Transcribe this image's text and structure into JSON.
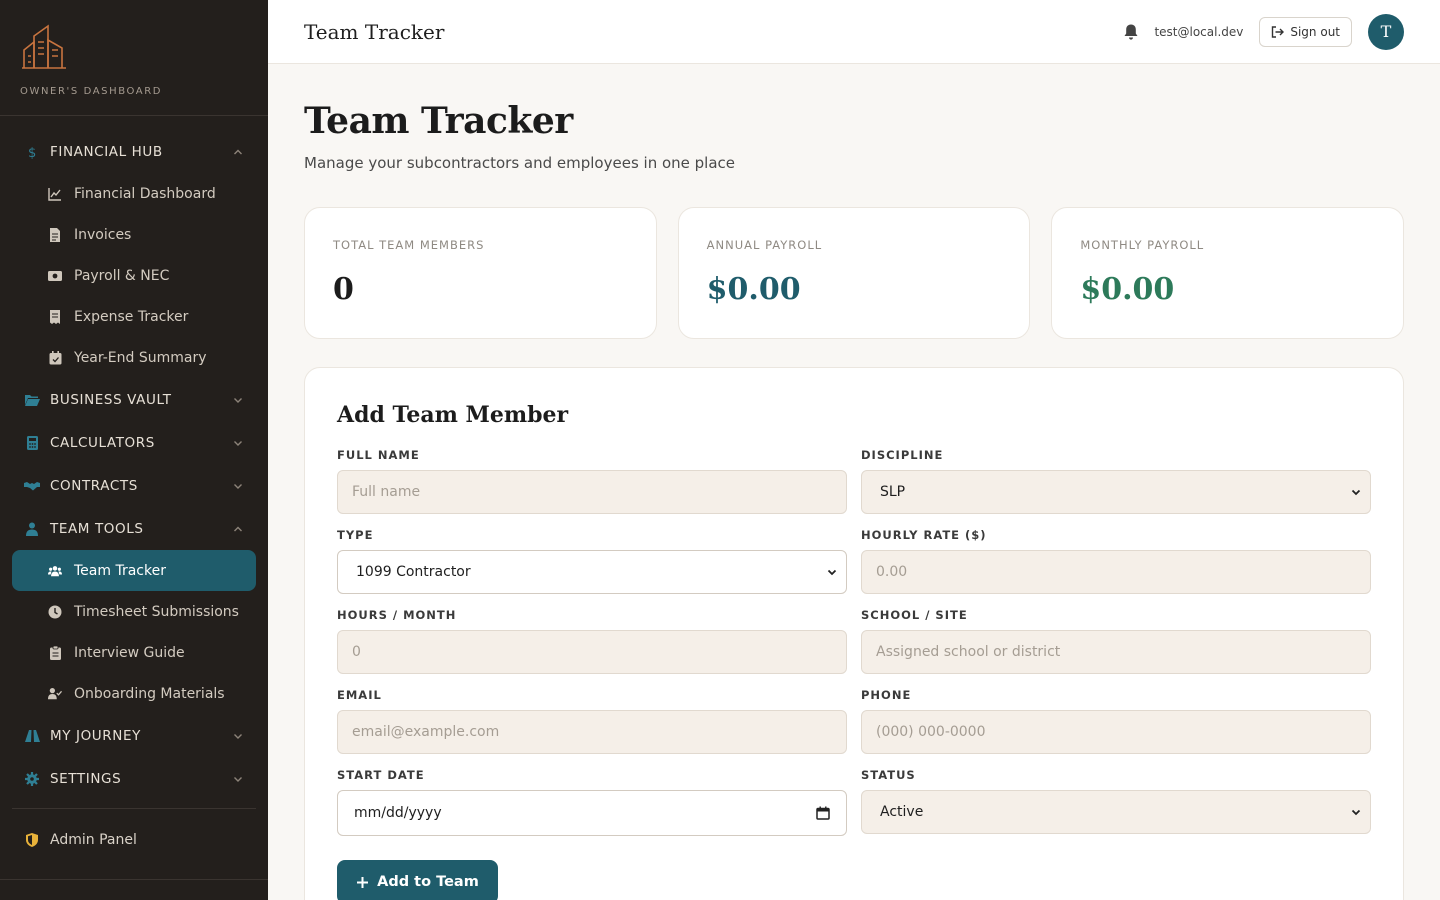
{
  "brand": {
    "text": "OWNER'S DASHBOARD"
  },
  "sidebar": {
    "financial_hub": {
      "label": "FINANCIAL HUB",
      "items": [
        {
          "label": "Financial Dashboard",
          "icon": "chart-line-icon"
        },
        {
          "label": "Invoices",
          "icon": "file-icon"
        },
        {
          "label": "Payroll & NEC",
          "icon": "money-icon"
        },
        {
          "label": "Expense Tracker",
          "icon": "receipt-icon"
        },
        {
          "label": "Year-End Summary",
          "icon": "calendar-icon"
        }
      ]
    },
    "business_vault": {
      "label": "BUSINESS VAULT"
    },
    "calculators": {
      "label": "CALCULATORS"
    },
    "contracts": {
      "label": "CONTRACTS"
    },
    "team_tools": {
      "label": "TEAM TOOLS",
      "items": [
        {
          "label": "Team Tracker",
          "icon": "users-icon",
          "active": true
        },
        {
          "label": "Timesheet Submissions",
          "icon": "clock-icon"
        },
        {
          "label": "Interview Guide",
          "icon": "clipboard-icon"
        },
        {
          "label": "Onboarding Materials",
          "icon": "user-check-icon"
        }
      ]
    },
    "my_journey": {
      "label": "MY JOURNEY"
    },
    "settings": {
      "label": "SETTINGS"
    },
    "admin": {
      "label": "Admin Panel"
    }
  },
  "topbar": {
    "title": "Team Tracker",
    "email": "test@local.dev",
    "signout": "Sign out",
    "avatar_initial": "T"
  },
  "page": {
    "title": "Team Tracker",
    "subtitle": "Manage your subcontractors and employees in one place"
  },
  "stats": [
    {
      "label": "TOTAL TEAM MEMBERS",
      "value": "0"
    },
    {
      "label": "ANNUAL PAYROLL",
      "value": "$0.00"
    },
    {
      "label": "MONTHLY PAYROLL",
      "value": "$0.00"
    }
  ],
  "form": {
    "title": "Add Team Member",
    "full_name": {
      "label": "FULL NAME",
      "placeholder": "Full name"
    },
    "discipline": {
      "label": "DISCIPLINE",
      "value": "SLP"
    },
    "type": {
      "label": "TYPE",
      "value": "1099 Contractor"
    },
    "hourly_rate": {
      "label": "HOURLY RATE ($)",
      "placeholder": "0.00"
    },
    "hours_month": {
      "label": "HOURS / MONTH",
      "placeholder": "0"
    },
    "school_site": {
      "label": "SCHOOL / SITE",
      "placeholder": "Assigned school or district"
    },
    "email": {
      "label": "EMAIL",
      "placeholder": "email@example.com"
    },
    "phone": {
      "label": "PHONE",
      "placeholder": "(000) 000-0000"
    },
    "start_date": {
      "label": "START DATE",
      "value": "mm/dd/yyyy"
    },
    "status": {
      "label": "STATUS",
      "value": "Active"
    },
    "submit": "Add to Team"
  },
  "colors": {
    "accent": "#1f5c6b",
    "sidebar_bg": "#231f1c",
    "money_teal": "#1f5c6b",
    "money_green": "#2d7a5a",
    "brand_orange": "#c8743f"
  }
}
